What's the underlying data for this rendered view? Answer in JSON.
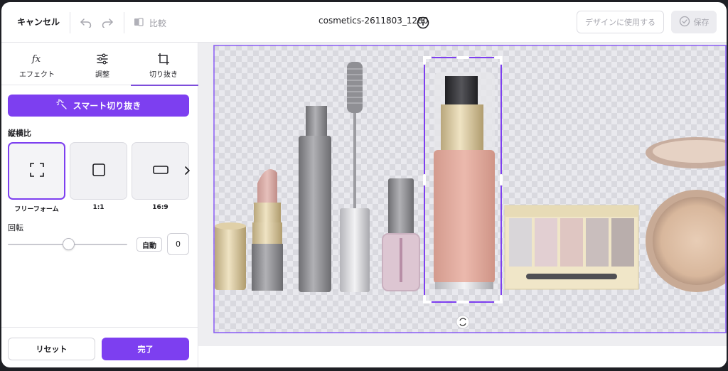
{
  "header": {
    "cancel_label": "キャンセル",
    "undo_icon": "undo-icon",
    "redo_icon": "redo-icon",
    "compare_label": "比較",
    "filename": "cosmetics-2611803_1280",
    "use_in_design_label": "デザインに使用する",
    "save_label": "保存"
  },
  "panel": {
    "tabs": [
      {
        "label": "エフェクト",
        "icon": "fx-icon"
      },
      {
        "label": "調整",
        "icon": "sliders-icon"
      },
      {
        "label": "切り抜き",
        "icon": "crop-icon"
      }
    ],
    "active_tab": "切り抜き",
    "smart_crop_label": "スマート切り抜き",
    "aspect_ratio_heading": "縦横比",
    "ratios": [
      {
        "label": "フリーフォーム",
        "icon": "freeform-icon"
      },
      {
        "label": "1:1",
        "icon": "square-icon"
      },
      {
        "label": "16:9",
        "icon": "wide-rect-icon"
      }
    ],
    "selected_ratio": "フリーフォーム",
    "rotation_heading": "回転",
    "rotation_value": "0",
    "auto_label": "自動",
    "reset_label": "リセット",
    "done_label": "完了"
  },
  "colors": {
    "accent": "#7d3ff0",
    "frame_border": "#8b5cf6"
  }
}
